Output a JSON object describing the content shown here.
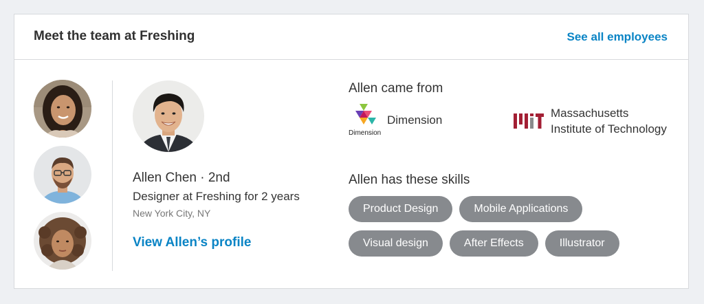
{
  "header": {
    "title": "Meet the team at Freshing",
    "see_all_label": "See all employees"
  },
  "team_avatars": [
    {
      "icon": "woman-portrait-avatar"
    },
    {
      "icon": "man-glasses-portrait-avatar"
    },
    {
      "icon": "woman-curly-hair-portrait-avatar"
    }
  ],
  "profile": {
    "name_line": "Allen Chen · 2nd",
    "role": "Designer at Freshing for 2 years",
    "location": "New York City, NY",
    "link_label": "View Allen’s profile"
  },
  "came_from": {
    "title": "Allen came from",
    "company": {
      "logo_caption": "Dimension",
      "name": "Dimension"
    },
    "school": {
      "name_line1": "Massachusetts",
      "name_line2": "Institute of Technology"
    }
  },
  "skills": {
    "title": "Allen has these skills",
    "rows": [
      [
        "Product Design",
        "Mobile Applications"
      ],
      [
        "Visual design",
        "After Effects",
        "Illustrator"
      ]
    ]
  },
  "colors": {
    "link": "#0a84c5",
    "pill_bg": "#878a8e",
    "mit_red": "#a31f34"
  }
}
